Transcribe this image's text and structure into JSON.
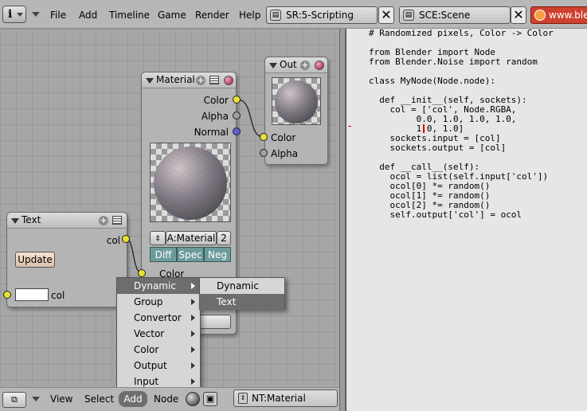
{
  "topbar": {
    "menu": [
      "File",
      "Add",
      "Timeline",
      "Game",
      "Render",
      "Help"
    ],
    "screen_field": "SR:5-Scripting",
    "scene_field": "SCE:Scene",
    "tab_url": "www.blender"
  },
  "nodes": {
    "material": {
      "title": "Material",
      "outputs": [
        "Color",
        "Alpha",
        "Normal"
      ],
      "material_field": "A:Material",
      "users": "2",
      "toggles": [
        "Diff",
        "Spec",
        "Neg"
      ],
      "input_color": "Color"
    },
    "out": {
      "title": "Out",
      "inputs": [
        "Color",
        "Alpha"
      ]
    },
    "text": {
      "title": "Text",
      "output": "col",
      "update_button": "Update",
      "input": "col"
    }
  },
  "add_menu": {
    "items": [
      "Dynamic",
      "Group",
      "Convertor",
      "Vector",
      "Color",
      "Output",
      "Input"
    ],
    "selected": "Dynamic",
    "submenu": [
      "Dynamic",
      "Text"
    ],
    "submenu_selected": "Text"
  },
  "code": [
    "# Randomized pixels, Color -> Color",
    "",
    "from Blender import Node",
    "from Blender.Noise import random",
    "",
    "class MyNode(Node.node):",
    "",
    "  def __init__(self, sockets):",
    "    col = ['col', Node.RGBA,",
    "         0.0, 1.0, 1.0, 1.0,",
    "         1.0, 1.0]",
    "    sockets.input = [col]",
    "    sockets.output = [col]",
    "",
    "  def __call__(self):",
    "    ocol = list(self.input['col'])",
    "    ocol[0] *= random()",
    "    ocol[1] *= random()",
    "    ocol[2] *= random()",
    "    self.output['col'] = ocol"
  ],
  "bottombar": {
    "menu": [
      "View",
      "Select",
      "Add",
      "Node"
    ],
    "active": "Add",
    "nodetree_field": "NT:Material"
  }
}
